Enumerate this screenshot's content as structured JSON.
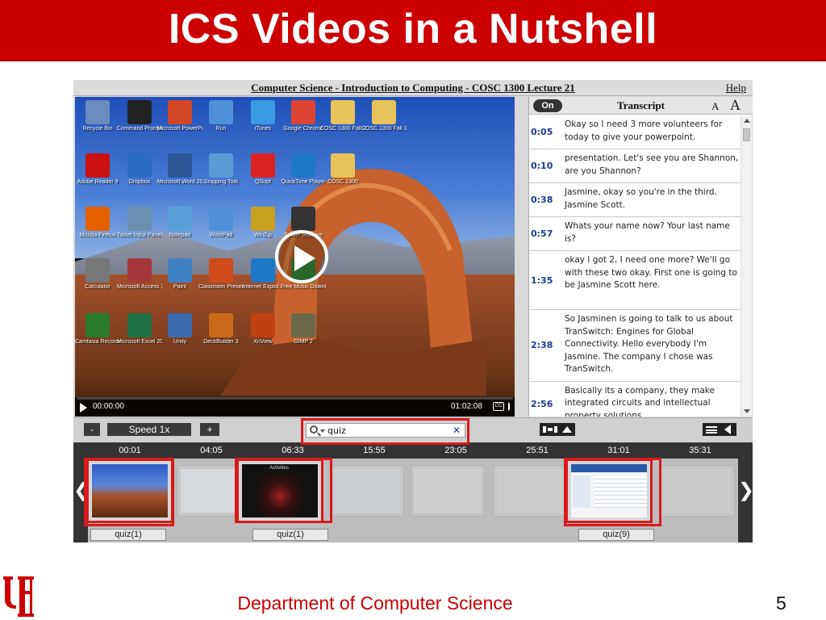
{
  "slide": {
    "title": "ICS Videos in a Nutshell",
    "footer": "Department of Computer Science",
    "page_number": "5"
  },
  "player": {
    "lecture_title": "Computer Science - Introduction to Computing - COSC 1300 Lecture 21",
    "help_label": "Help",
    "video": {
      "current_time": "00:00:00",
      "duration": "01:02:08",
      "progress": 0,
      "cc_label": "CC",
      "desktop_icons": [
        "Recycle Bin",
        "Command Prompt",
        "Microsoft PowerPoi...",
        "Run",
        "iTunes",
        "Google Chrome",
        "COSC 1300 Fall 2012",
        "COSC 1300 Fall 12",
        "Adobe Reader 9",
        "Dropbox",
        "Microsoft Word 2010",
        "Snipping Tool",
        "QSopt",
        "QuickTime Player",
        "COSC 1300",
        "Mozilla Firefox",
        "Tablet Input Panel",
        "Notepad",
        "WordPad",
        "WinZip",
        "Spider Solitaire",
        "Calculator",
        "Microsoft Access 2010",
        "Paint",
        "Classroom Presenter 3",
        "Internet Explor...",
        "Free Music Downloads",
        "Camtasia Recorder",
        "Microsoft Excel 2010",
        "Unity",
        "DeckBuilder 3",
        "XnView",
        "GIMP 2"
      ]
    },
    "transcript": {
      "toggle_label": "On",
      "title": "Transcript",
      "font_small": "A",
      "font_large": "A",
      "entries": [
        {
          "time": "0:05",
          "text": "Okay so I need 3 more volunteers for today to give your powerpoint."
        },
        {
          "time": "0:10",
          "text": "presentation. Let's see you are Shannon, are you Shannon?"
        },
        {
          "time": "0:38",
          "text": "Jasmine, okay so you're in the third. Jasmine Scott."
        },
        {
          "time": "0:57",
          "text": "Whats your name now? Your last name is?"
        },
        {
          "time": "1:35",
          "text": "okay I got 2, I need one more? We'll go with these two okay. First one is going to be Jasmine Scott here."
        },
        {
          "time": "2:38",
          "text": "So Jasminen is going to talk to us about TranSwitch: Engines for Global Connectivity. Hello everybody I'm Jasmine. The company I chose was TranSwitch."
        },
        {
          "time": "2:56",
          "text": "Basically its a company, they make integrated circuits and intellectual property solutions."
        }
      ]
    },
    "controls": {
      "minus_label": "-",
      "speed_label": "Speed 1x",
      "plus_label": "+",
      "search_value": "quiz",
      "clear_label": "✕"
    },
    "strip": {
      "timestamps": [
        "00:01",
        "04:05",
        "06:33",
        "15:55",
        "23:05",
        "25:51",
        "31:01",
        "35:31"
      ],
      "matches": [
        "quiz(1)",
        "quiz(1)",
        "quiz(9)"
      ],
      "frame2_caption": "Activities",
      "prev_label": "❮",
      "next_label": "❯"
    }
  },
  "colors": {
    "title_bar": "#cc0000",
    "highlight": "#d91a1a",
    "timestamp_blue": "#1a3a8f"
  }
}
